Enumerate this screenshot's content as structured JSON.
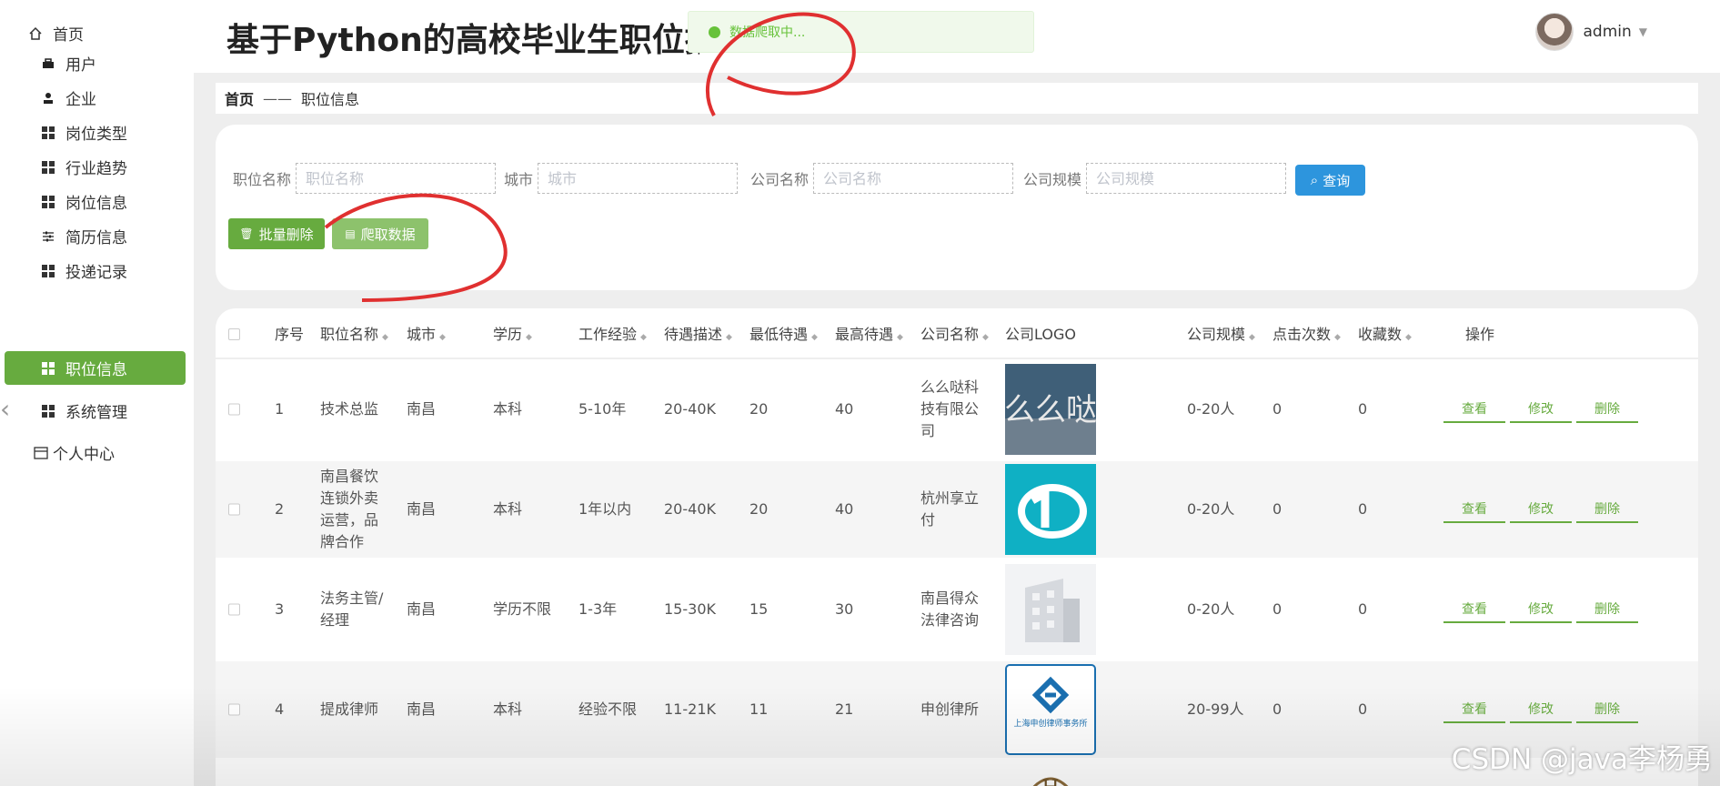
{
  "sidebar": {
    "items": [
      {
        "label": "首页",
        "icon": "home-icon"
      },
      {
        "label": "用户",
        "icon": "user-group-icon"
      },
      {
        "label": "企业",
        "icon": "person-icon"
      },
      {
        "label": "岗位类型",
        "icon": "grid-icon"
      },
      {
        "label": "行业趋势",
        "icon": "grid-icon"
      },
      {
        "label": "岗位信息",
        "icon": "grid-icon"
      },
      {
        "label": "简历信息",
        "icon": "sliders-icon"
      },
      {
        "label": "投递记录",
        "icon": "grid-icon"
      },
      {
        "label": "职位信息",
        "icon": "grid-icon",
        "active": true
      },
      {
        "label": "系统管理",
        "icon": "grid-icon"
      },
      {
        "label": "个人中心",
        "icon": "card-icon"
      }
    ]
  },
  "header": {
    "title": "基于Python的高校毕业生职位推",
    "toast": "数据爬取中...",
    "username": "admin"
  },
  "breadcrumb": {
    "home": "首页",
    "separator": "——",
    "current": "职位信息"
  },
  "search": {
    "fields": [
      {
        "label": "职位名称",
        "placeholder": "职位名称"
      },
      {
        "label": "城市",
        "placeholder": "城市"
      },
      {
        "label": "公司名称",
        "placeholder": "公司名称"
      },
      {
        "label": "公司规模",
        "placeholder": "公司规模"
      }
    ],
    "query_label": "查询",
    "batch_delete_label": "批量删除",
    "crawl_label": "爬取数据"
  },
  "table": {
    "headers": [
      "序号",
      "职位名称",
      "城市",
      "学历",
      "工作经验",
      "待遇描述",
      "最低待遇",
      "最高待遇",
      "公司名称",
      "公司LOGO",
      "公司规模",
      "点击次数",
      "收藏数",
      "操作"
    ],
    "actions": {
      "view": "查看",
      "edit": "修改",
      "delete": "删除"
    },
    "rows": [
      {
        "no": "1",
        "title": "技术总监",
        "city": "南昌",
        "edu": "本科",
        "exp": "5-10年",
        "salary": "20-40K",
        "min": "20",
        "max": "40",
        "company": "么么哒科技有限公司",
        "size": "0-20人",
        "clicks": "0",
        "favs": "0",
        "logo": "mmd-logo"
      },
      {
        "no": "2",
        "title": "南昌餐饮连锁外卖运营，品牌合作",
        "city": "南昌",
        "edu": "本科",
        "exp": "1年以内",
        "salary": "20-40K",
        "min": "20",
        "max": "40",
        "company": "杭州享立付",
        "size": "0-20人",
        "clicks": "0",
        "favs": "0",
        "logo": "xlf-logo"
      },
      {
        "no": "3",
        "title": "法务主管/经理",
        "city": "南昌",
        "edu": "学历不限",
        "exp": "1-3年",
        "salary": "15-30K",
        "min": "15",
        "max": "30",
        "company": "南昌得众法律咨询",
        "size": "0-20人",
        "clicks": "0",
        "favs": "0",
        "logo": "building-logo"
      },
      {
        "no": "4",
        "title": "提成律师",
        "city": "南昌",
        "edu": "本科",
        "exp": "经验不限",
        "salary": "11-21K",
        "min": "11",
        "max": "21",
        "company": "申创律所",
        "size": "20-99人",
        "clicks": "0",
        "favs": "0",
        "logo": "shenchuang-logo",
        "logo_text": "上海申创律师事务所"
      }
    ]
  },
  "watermark": "CSDN @java李杨勇",
  "colors": {
    "primary": "#67ab3f",
    "query": "#2d95dd",
    "crawl": "#8dc26c",
    "toast_bg": "#f0f9eb",
    "toast_text": "#67c23a"
  }
}
